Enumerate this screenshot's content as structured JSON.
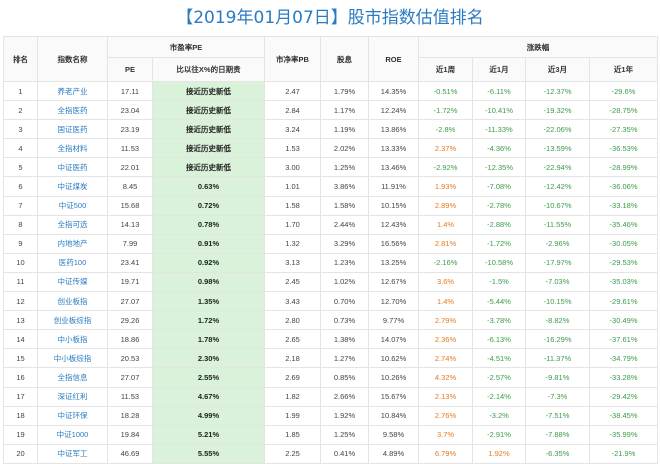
{
  "title": "【2019年01月07日】股市指数估值排名",
  "headers": {
    "rank": "排名",
    "name": "指数名称",
    "pe_group": "市盈率PE",
    "pe": "PE",
    "pe_pct": "比以往X%的日期贵",
    "pb": "市净率PB",
    "dividend": "股息",
    "roe": "ROE",
    "chg_group": "涨跌幅",
    "w1": "近1周",
    "m1": "近1月",
    "m3": "近3月",
    "y1": "近1年"
  },
  "rows": [
    {
      "rank": "1",
      "name": "养老产业",
      "pe": "17.11",
      "pct": "接近历史新低",
      "pb": "2.47",
      "div": "1.79%",
      "roe": "14.35%",
      "w1": "-0.51%",
      "m1": "-6.11%",
      "m3": "-12.37%",
      "y1": "-29.6%"
    },
    {
      "rank": "2",
      "name": "全指医药",
      "pe": "23.04",
      "pct": "接近历史新低",
      "pb": "2.84",
      "div": "1.17%",
      "roe": "12.24%",
      "w1": "-1.72%",
      "m1": "-10.41%",
      "m3": "-19.32%",
      "y1": "-28.75%"
    },
    {
      "rank": "3",
      "name": "国证医药",
      "pe": "23.19",
      "pct": "接近历史新低",
      "pb": "3.24",
      "div": "1.19%",
      "roe": "13.86%",
      "w1": "-2.8%",
      "m1": "-11.33%",
      "m3": "-22.06%",
      "y1": "-27.35%"
    },
    {
      "rank": "4",
      "name": "全指材料",
      "pe": "11.53",
      "pct": "接近历史新低",
      "pb": "1.53",
      "div": "2.02%",
      "roe": "13.33%",
      "w1": "2.37%",
      "m1": "-4.36%",
      "m3": "-13.59%",
      "y1": "-36.53%"
    },
    {
      "rank": "5",
      "name": "中证医药",
      "pe": "22.01",
      "pct": "接近历史新低",
      "pb": "3.00",
      "div": "1.25%",
      "roe": "13.46%",
      "w1": "-2.92%",
      "m1": "-12.35%",
      "m3": "-22.94%",
      "y1": "-28.99%"
    },
    {
      "rank": "6",
      "name": "中证煤炭",
      "pe": "8.45",
      "pct": "0.63%",
      "pb": "1.01",
      "div": "3.86%",
      "roe": "11.91%",
      "w1": "1.93%",
      "m1": "-7.08%",
      "m3": "-12.42%",
      "y1": "-36.06%"
    },
    {
      "rank": "7",
      "name": "中证500",
      "pe": "15.68",
      "pct": "0.72%",
      "pb": "1.58",
      "div": "1.58%",
      "roe": "10.15%",
      "w1": "2.89%",
      "m1": "-2.78%",
      "m3": "-10.67%",
      "y1": "-33.18%"
    },
    {
      "rank": "8",
      "name": "全指可选",
      "pe": "14.13",
      "pct": "0.78%",
      "pb": "1.70",
      "div": "2.44%",
      "roe": "12.43%",
      "w1": "1.4%",
      "m1": "-2.88%",
      "m3": "-11.55%",
      "y1": "-35.46%"
    },
    {
      "rank": "9",
      "name": "内地地产",
      "pe": "7.99",
      "pct": "0.91%",
      "pb": "1.32",
      "div": "3.29%",
      "roe": "16.56%",
      "w1": "2.81%",
      "m1": "-1.72%",
      "m3": "-2.96%",
      "y1": "-30.05%"
    },
    {
      "rank": "10",
      "name": "医药100",
      "pe": "23.41",
      "pct": "0.92%",
      "pb": "3.13",
      "div": "1.23%",
      "roe": "13.25%",
      "w1": "-2.16%",
      "m1": "-10.58%",
      "m3": "-17.97%",
      "y1": "-29.53%"
    },
    {
      "rank": "11",
      "name": "中证传媒",
      "pe": "19.71",
      "pct": "0.98%",
      "pb": "2.45",
      "div": "1.02%",
      "roe": "12.67%",
      "w1": "3.6%",
      "m1": "-1.5%",
      "m3": "-7.03%",
      "y1": "-35.03%"
    },
    {
      "rank": "12",
      "name": "创业板指",
      "pe": "27.07",
      "pct": "1.35%",
      "pb": "3.43",
      "div": "0.70%",
      "roe": "12.70%",
      "w1": "1.4%",
      "m1": "-5.44%",
      "m3": "-10.15%",
      "y1": "-29.61%"
    },
    {
      "rank": "13",
      "name": "创业板综指",
      "pe": "29.26",
      "pct": "1.72%",
      "pb": "2.80",
      "div": "0.73%",
      "roe": "9.77%",
      "w1": "2.79%",
      "m1": "-3.78%",
      "m3": "-8.82%",
      "y1": "-30.49%"
    },
    {
      "rank": "14",
      "name": "中小板指",
      "pe": "18.86",
      "pct": "1.78%",
      "pb": "2.65",
      "div": "1.38%",
      "roe": "14.07%",
      "w1": "2.36%",
      "m1": "-6.13%",
      "m3": "-16.29%",
      "y1": "-37.61%"
    },
    {
      "rank": "15",
      "name": "中小板综指",
      "pe": "20.53",
      "pct": "2.30%",
      "pb": "2.18",
      "div": "1.27%",
      "roe": "10.62%",
      "w1": "2.74%",
      "m1": "-4.51%",
      "m3": "-11.37%",
      "y1": "-34.79%"
    },
    {
      "rank": "16",
      "name": "全指信息",
      "pe": "27.07",
      "pct": "2.55%",
      "pb": "2.69",
      "div": "0.85%",
      "roe": "10.26%",
      "w1": "4.32%",
      "m1": "-2.57%",
      "m3": "-9.81%",
      "y1": "-33.28%"
    },
    {
      "rank": "17",
      "name": "深证红利",
      "pe": "11.53",
      "pct": "4.67%",
      "pb": "1.82",
      "div": "2.66%",
      "roe": "15.67%",
      "w1": "2.13%",
      "m1": "-2.14%",
      "m3": "-7.3%",
      "y1": "-29.42%"
    },
    {
      "rank": "18",
      "name": "中证环保",
      "pe": "18.28",
      "pct": "4.99%",
      "pb": "1.99",
      "div": "1.92%",
      "roe": "10.84%",
      "w1": "2.76%",
      "m1": "-3.2%",
      "m3": "-7.51%",
      "y1": "-38.45%"
    },
    {
      "rank": "19",
      "name": "中证1000",
      "pe": "19.84",
      "pct": "5.21%",
      "pb": "1.85",
      "div": "1.25%",
      "roe": "9.58%",
      "w1": "3.7%",
      "m1": "-2.91%",
      "m3": "-7.88%",
      "y1": "-35.99%"
    },
    {
      "rank": "20",
      "name": "中证军工",
      "pe": "46.69",
      "pct": "5.55%",
      "pb": "2.25",
      "div": "0.41%",
      "roe": "4.89%",
      "w1": "6.79%",
      "m1": "1.92%",
      "m3": "-6.35%",
      "y1": "-21.9%"
    }
  ],
  "colors": {
    "title": "#2a7bc1",
    "name": "#2a7bc1",
    "positive": "#e57a1f",
    "negative": "#3d9b4a",
    "pct_bg": "#d9f2d9",
    "border": "#e4e4e4"
  }
}
